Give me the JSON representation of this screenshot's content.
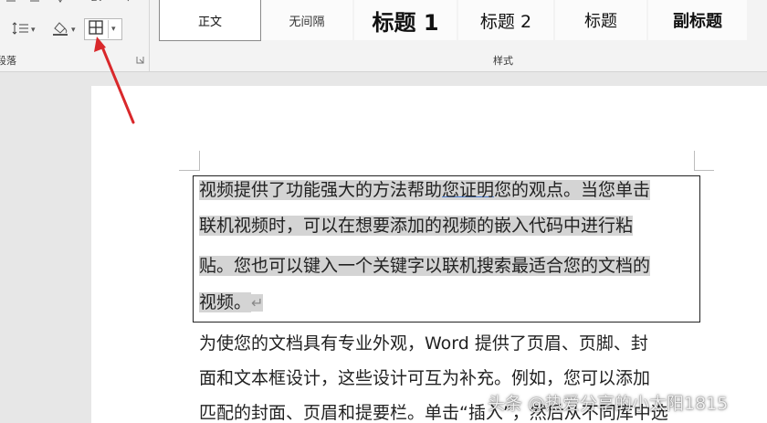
{
  "ribbon": {
    "paragraph_group": {
      "label": "段落",
      "line_spacing_icon": "line-spacing-icon",
      "shading_icon": "shading-icon",
      "borders_icon": "borders-icon"
    },
    "styles_group": {
      "label": "样式",
      "styles": [
        {
          "label": "正文",
          "selected": true
        },
        {
          "label": "无间隔",
          "selected": false
        },
        {
          "label": "标题 1",
          "selected": false
        },
        {
          "label": "标题 2",
          "selected": false
        },
        {
          "label": "标题",
          "selected": false
        },
        {
          "label": "副标题",
          "selected": false
        }
      ]
    }
  },
  "document": {
    "selected_lines": [
      {
        "before": "视频提供了功能强大的方法帮助",
        "link": "您证明",
        "after": "您的观点。当您单击"
      },
      {
        "text": "联机视频时，可以在想要添加的视频的嵌入代码中进行粘"
      },
      {
        "text": "贴。您也可以键入一个关键字以联机搜索最适合您的文档的"
      },
      {
        "text": "视频。",
        "mark": "↵"
      }
    ],
    "lines": [
      "为使您的文档具有专业外观，Word 提供了页眉、页脚、封",
      "面和文本框设计，这些设计可互为补充。例如，您可以添加",
      "匹配的封面、页眉和提要栏。单击“插入”，然后从不同库中选"
    ]
  },
  "watermark": "头条 @热爱分享的小太阳1815",
  "colors": {
    "ribbon_bg": "#f3f3f3",
    "selection": "#d4d4d4",
    "arrow": "#d9282b"
  }
}
